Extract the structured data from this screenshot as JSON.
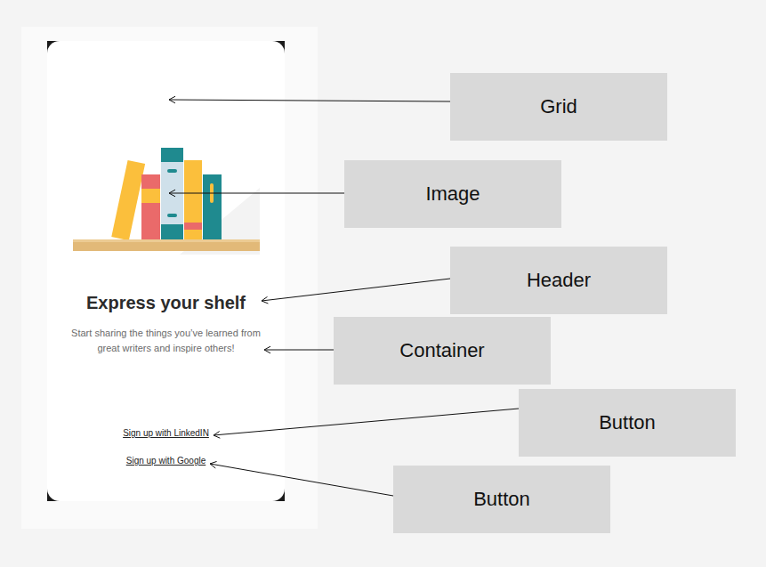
{
  "screen": {
    "header": "Express your shelf",
    "subtitle": "Start sharing the things you’ve learned from great writers and inspire others!",
    "buttons": [
      "Sign up with LinkedIN",
      "Sign up with Google"
    ]
  },
  "annotations": [
    {
      "label": "Grid"
    },
    {
      "label": "Image"
    },
    {
      "label": "Header"
    },
    {
      "label": "Container"
    },
    {
      "label": "Button"
    },
    {
      "label": "Button"
    }
  ]
}
